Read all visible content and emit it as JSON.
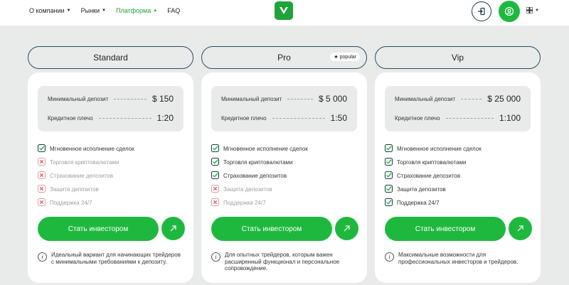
{
  "header": {
    "nav": [
      {
        "label": "О компании",
        "has_dropdown": true,
        "active": false
      },
      {
        "label": "Рынки",
        "has_dropdown": true,
        "active": false
      },
      {
        "label": "Платформа",
        "has_dropdown": true,
        "active": true
      },
      {
        "label": "FAQ",
        "has_dropdown": false,
        "active": false
      }
    ],
    "logo_icon": "v-logo-icon",
    "login_icon": "login-icon",
    "profile_icon": "user-icon",
    "lang_icon": "grid-icon"
  },
  "colors": {
    "accent": "#1fb83f",
    "brand": "#1fa33a",
    "dark": "#173b4e",
    "background": "#e9ebea"
  },
  "plans": [
    {
      "name": "Standard",
      "badge": "",
      "params": [
        {
          "label": "Минимальный депозит",
          "value": "$ 150"
        },
        {
          "label": "Кредитное плечо",
          "value": "1:20"
        }
      ],
      "features": [
        {
          "label": "Мгновенное исполнение сделок",
          "included": true
        },
        {
          "label": "Торговля криптовалютами",
          "included": false
        },
        {
          "label": "Страхование депозитов",
          "included": false
        },
        {
          "label": "Защита депозитов",
          "included": false
        },
        {
          "label": "Поддержка 24/7",
          "included": false
        }
      ],
      "cta": "Стать инвестором",
      "info": "Идеальный вариант для начинающих трейдеров с минимальными требованиями к депозиту."
    },
    {
      "name": "Pro",
      "badge": "popular",
      "params": [
        {
          "label": "Минимальный депозит",
          "value": "$ 5 000"
        },
        {
          "label": "Кредитное плечо",
          "value": "1:50"
        }
      ],
      "features": [
        {
          "label": "Мгновенное исполнение сделок",
          "included": true
        },
        {
          "label": "Торговля криптовалютами",
          "included": true
        },
        {
          "label": "Страхование депозитов",
          "included": true
        },
        {
          "label": "Защита депозитов",
          "included": false
        },
        {
          "label": "Поддержка 24/7",
          "included": false
        }
      ],
      "cta": "Стать инвестором",
      "info": "Для опытных трейдеров, которым важен расширенный функционал и персональное сопровождение."
    },
    {
      "name": "Vip",
      "badge": "",
      "params": [
        {
          "label": "Минимальный депозит",
          "value": "$ 25 000"
        },
        {
          "label": "Кредитное плечо",
          "value": "1:100"
        }
      ],
      "features": [
        {
          "label": "Мгновенное исполнение сделок",
          "included": true
        },
        {
          "label": "Торговля криптовалютами",
          "included": true
        },
        {
          "label": "Страхование депозитов",
          "included": true
        },
        {
          "label": "Защита депозитов",
          "included": true
        },
        {
          "label": "Поддержка 24/7",
          "included": true
        }
      ],
      "cta": "Стать инвестором",
      "info": "Максимальные возможности для профессиональных инвесторов и трейдеров."
    }
  ]
}
